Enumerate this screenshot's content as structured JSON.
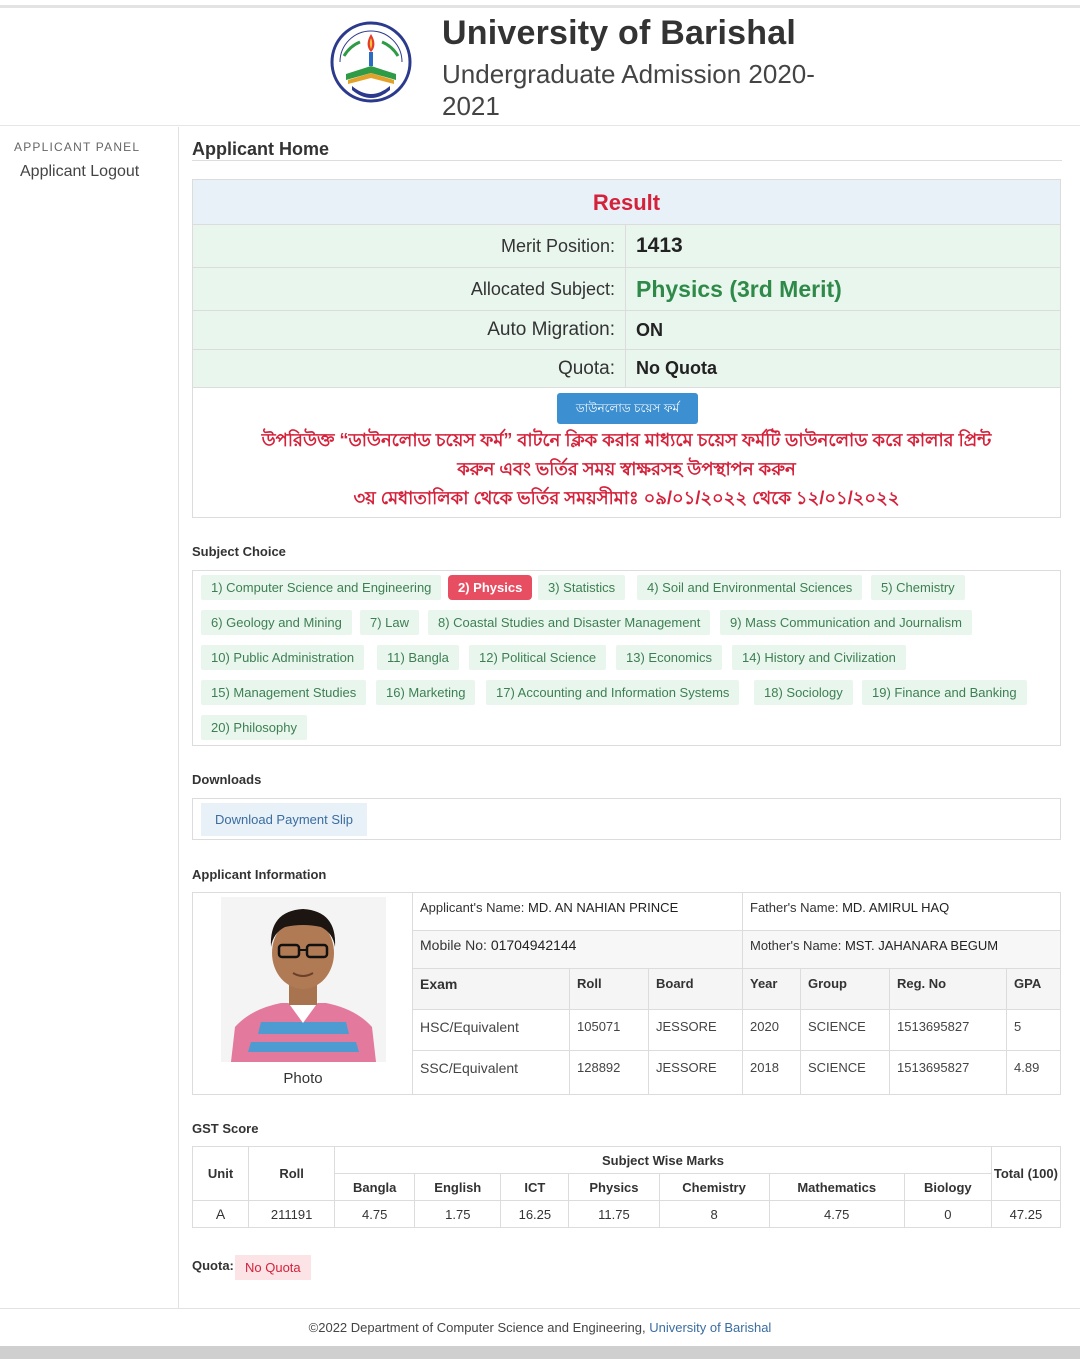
{
  "header": {
    "title": "University of Barishal",
    "subtitle": "Undergraduate Admission 2020-2021"
  },
  "sidebar": {
    "panel_label": "APPLICANT PANEL",
    "logout": "Applicant Logout"
  },
  "page_heading": "Applicant Home",
  "result": {
    "title": "Result",
    "rows": [
      {
        "label": "Merit Position:",
        "value": "1413"
      },
      {
        "label": "Allocated Subject:",
        "value": "Physics (3rd Merit)"
      },
      {
        "label": "Auto Migration:",
        "value": "ON"
      },
      {
        "label": "Quota:",
        "value": "No Quota"
      }
    ],
    "download_choice_button": "ডাউনলোড চয়েস ফর্ম",
    "notice_line1": "উপরিউক্ত “ডাউনলোড চয়েস ফর্ম” বাটনে ক্লিক করার মাধ্যমে চয়েস ফর্মটি ডাউনলোড করে কালার প্রিন্ট",
    "notice_line2": "করুন এবং ভর্তির সময় স্বাক্ষরসহ উপস্থাপন করুন",
    "notice_line3": "৩য় মেধাতালিকা থেকে ভর্তির সময়সীমাঃ ০৯/০১/২০২২ থেকে ১২/০১/২০২২",
    "colors": {
      "title": "#d5223b",
      "subject": "#2f8a4a"
    }
  },
  "subject_choice": {
    "label": "Subject Choice",
    "items": [
      "1) Computer Science and Engineering",
      "2) Physics",
      "3) Statistics",
      "4) Soil and Environmental Sciences",
      "5) Chemistry",
      "6) Geology and Mining",
      "7) Law",
      "8) Coastal Studies and Disaster Management",
      "9) Mass Communication and Journalism",
      "10) Public Administration",
      "11) Bangla",
      "12) Political Science",
      "13) Economics",
      "14) History and Civilization",
      "15) Management Studies",
      "16) Marketing",
      "17) Accounting and Information Systems",
      "18) Sociology",
      "19) Finance and Banking",
      "20) Philosophy"
    ],
    "selected": "2) Physics"
  },
  "downloads": {
    "label": "Downloads",
    "payment_slip": "Download Payment Slip"
  },
  "applicant": {
    "label": "Applicant Information",
    "photo_label": "Photo",
    "name_label": "Applicant's Name:",
    "name": "MD. AN NAHIAN PRINCE",
    "father_label": "Father's Name:",
    "father": "MD. AMIRUL HAQ",
    "mobile_label": "Mobile No:",
    "mobile": "01704942144",
    "mother_label": "Mother's Name:",
    "mother": "MST. JAHANARA BEGUM",
    "exam_headers": [
      "Exam",
      "Roll",
      "Board",
      "Year",
      "Group",
      "Reg. No",
      "GPA"
    ],
    "exams": [
      [
        "HSC/Equivalent",
        "105071",
        "JESSORE",
        "2020",
        "SCIENCE",
        "1513695827",
        "5"
      ],
      [
        "SSC/Equivalent",
        "128892",
        "JESSORE",
        "2018",
        "SCIENCE",
        "1513695827",
        "4.89"
      ]
    ]
  },
  "gst": {
    "label": "GST Score",
    "unit_header": "Unit",
    "roll_header": "Roll",
    "subject_wise_header": "Subject Wise Marks",
    "total_header": "Total (100)",
    "subjects": [
      "Bangla",
      "English",
      "ICT",
      "Physics",
      "Chemistry",
      "Mathematics",
      "Biology"
    ],
    "row": {
      "unit": "A",
      "roll": "211191",
      "marks": [
        "4.75",
        "1.75",
        "16.25",
        "11.75",
        "8",
        "4.75",
        "0"
      ],
      "total": "47.25"
    }
  },
  "quota": {
    "label": "Quota:",
    "value": "No Quota"
  },
  "footer": {
    "text": "©2022 Department of Computer Science and Engineering, ",
    "link": "University of Barishal"
  }
}
